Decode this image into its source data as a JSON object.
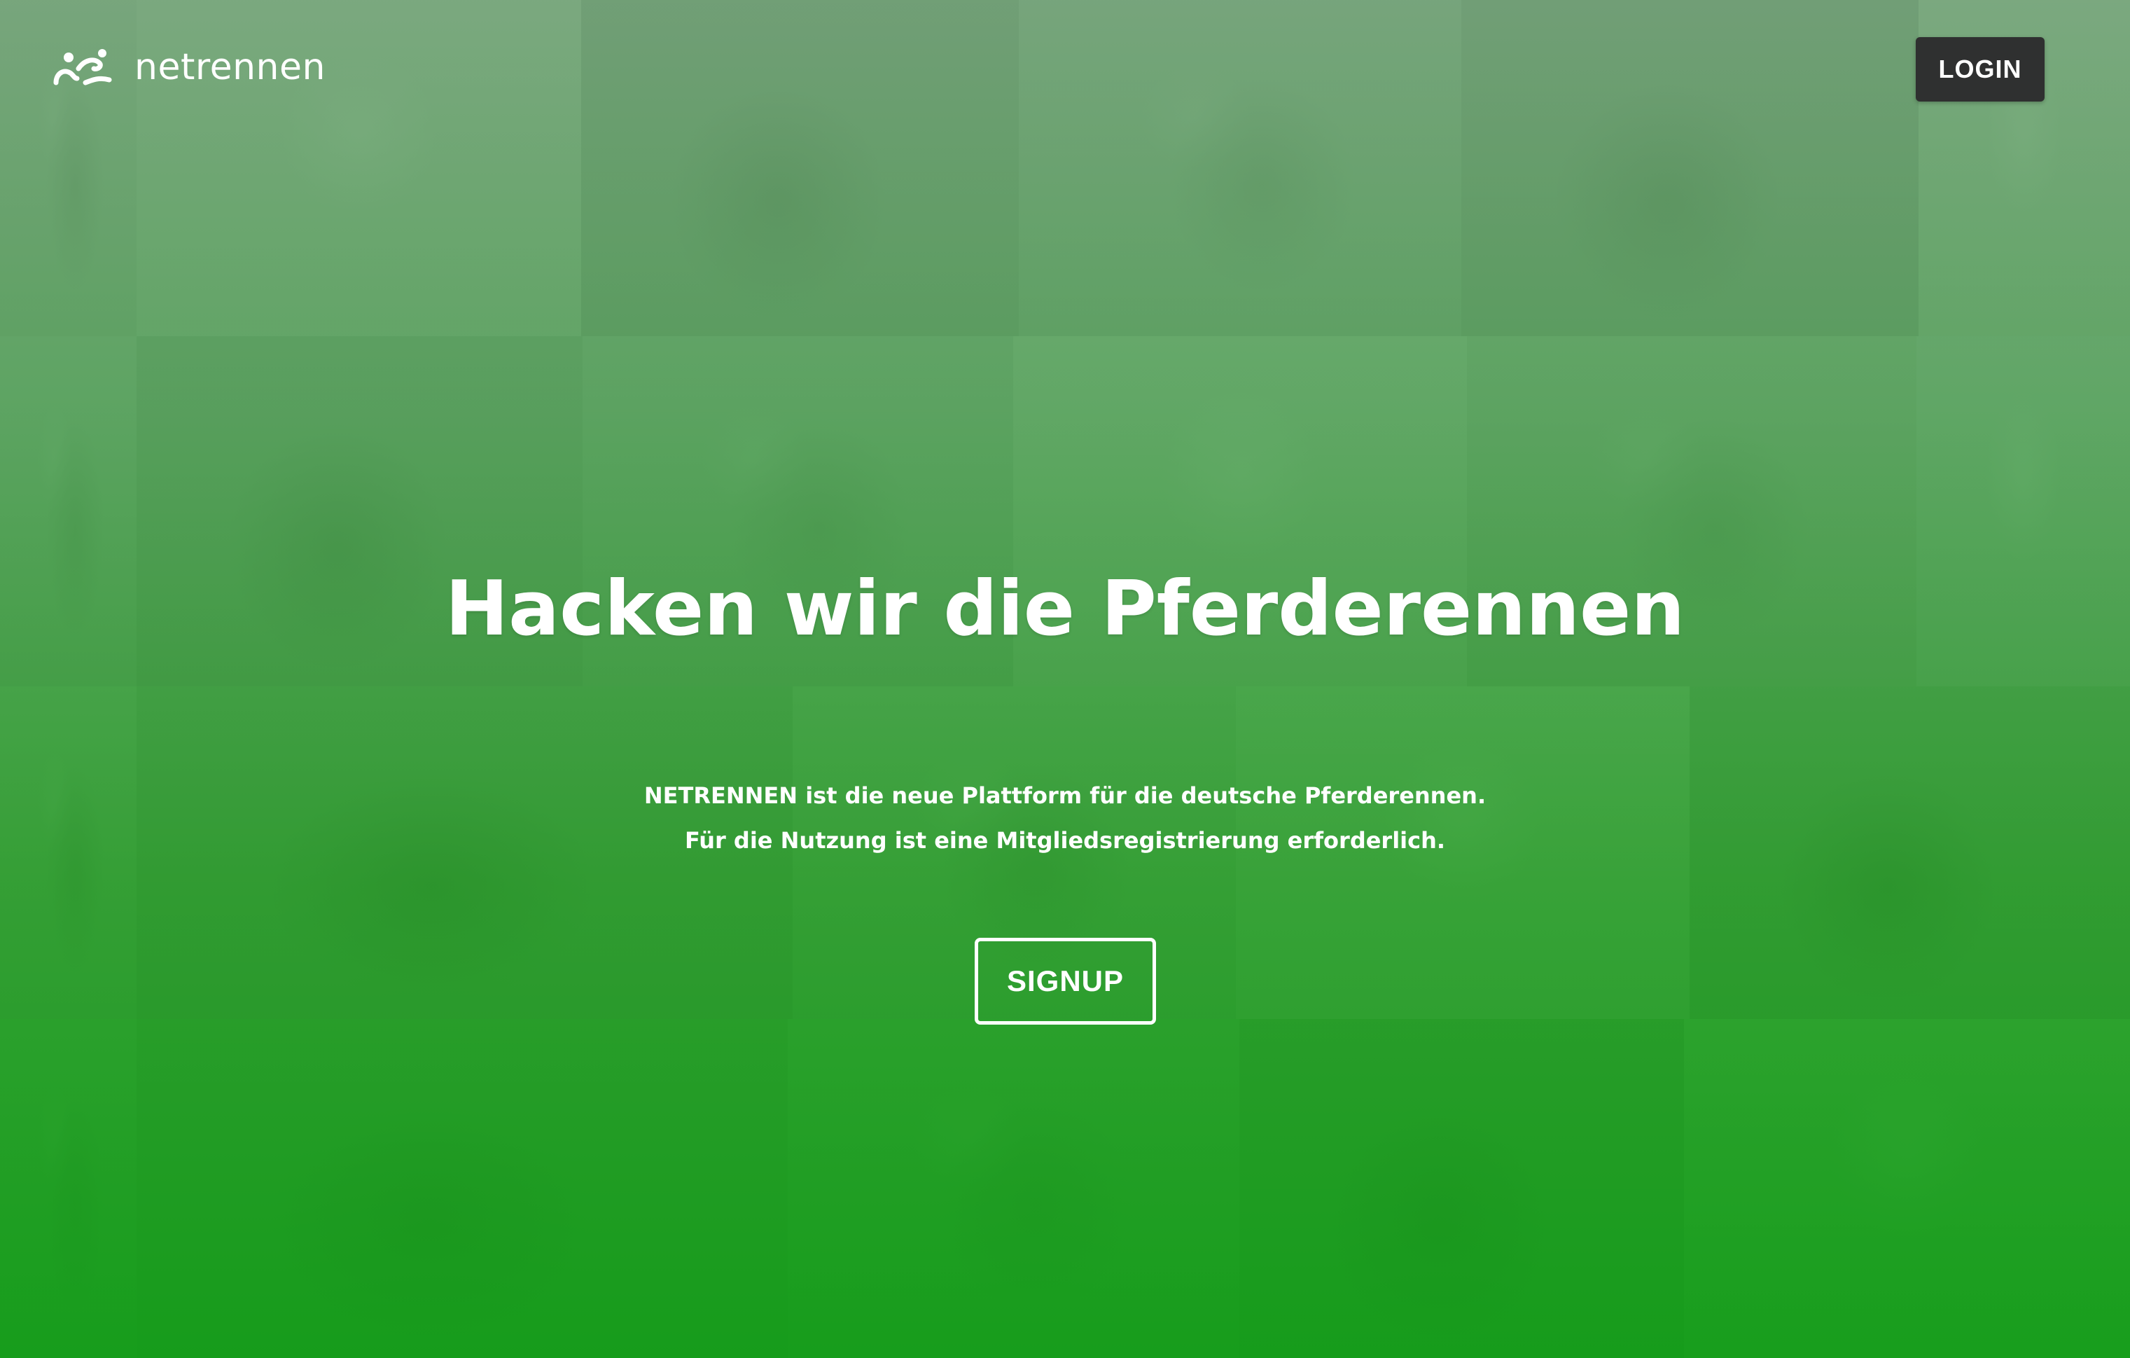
{
  "brand": {
    "name": "netrennen",
    "logo_icon": "horse-racing-logo-icon"
  },
  "header": {
    "login_label": "LOGIN"
  },
  "hero": {
    "title": "Hacken wir die Pferderennen",
    "subtitle_lines": [
      "NETRENNEN ist die neue Plattform für die deutsche Pferderennen.",
      "Für die Nutzung ist eine Mitgliedsregistrierung erforderlich."
    ],
    "signup_label": "SIGNUP"
  },
  "colors": {
    "overlay_top": "#7fae82",
    "overlay_bottom": "#14a019",
    "login_bg": "#2f3030",
    "text": "#ffffff"
  }
}
